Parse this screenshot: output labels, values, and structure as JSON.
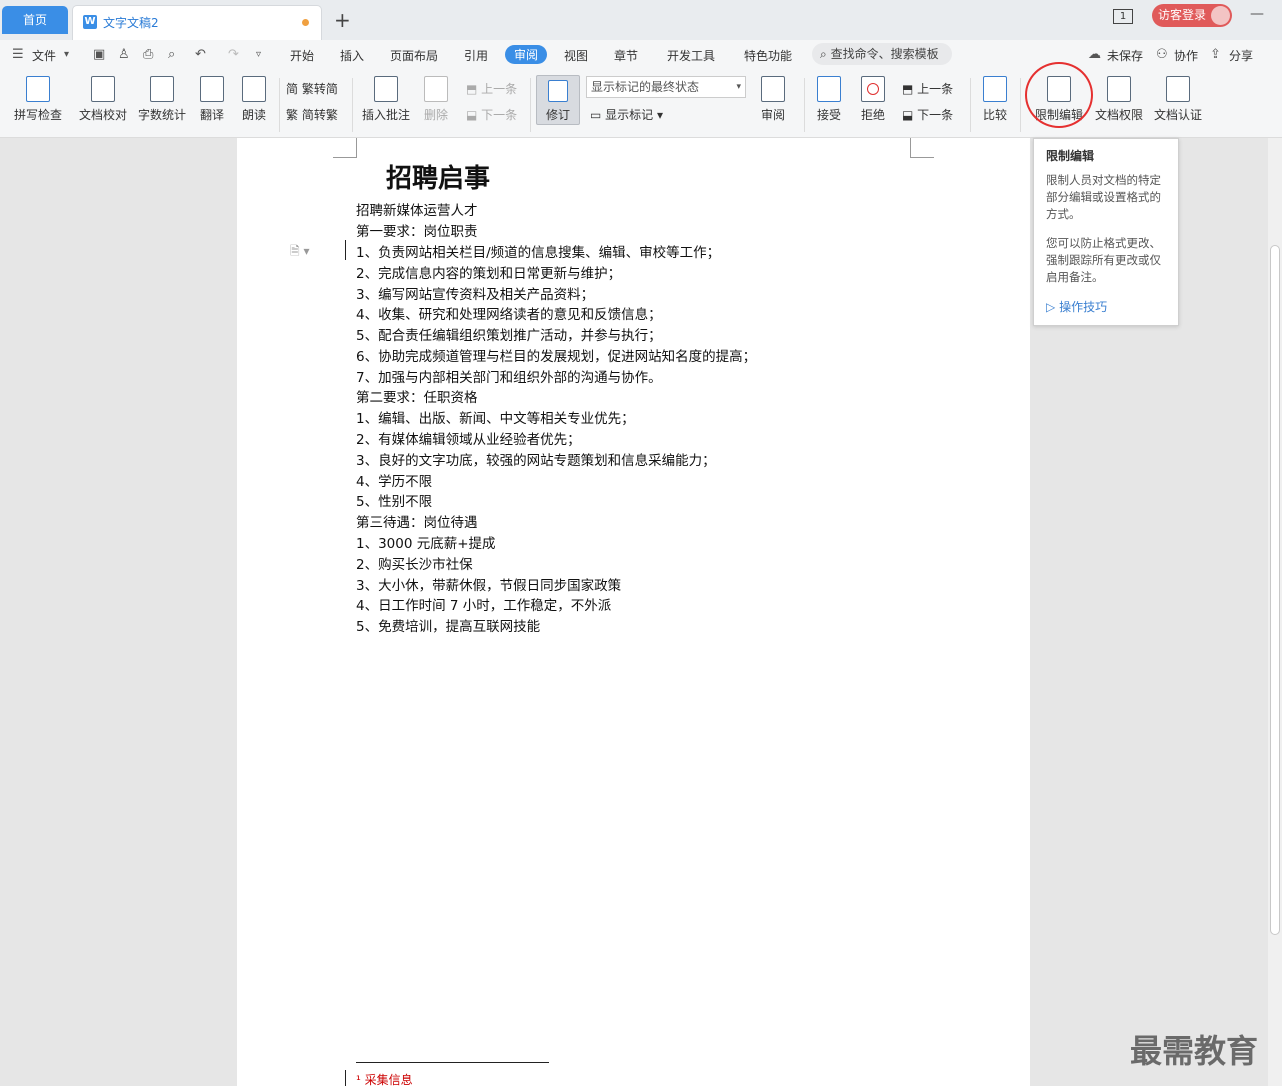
{
  "tabs": {
    "home": "首页",
    "doc": "文字文稿2",
    "add": "+"
  },
  "titlebar": {
    "win_num": "1",
    "login": "访客登录",
    "minimize": "—",
    "restore": "□"
  },
  "menu": {
    "file": "文件",
    "items": [
      "开始",
      "插入",
      "页面布局",
      "引用",
      "审阅",
      "视图",
      "章节",
      "开发工具",
      "特色功能"
    ],
    "active": "审阅",
    "search": "查找命令、搜索模板",
    "unsaved": "未保存",
    "collab": "协作",
    "share": "分享"
  },
  "ribbon": {
    "spell": "拼写检查",
    "proof": "文档校对",
    "wordcount": "字数统计",
    "translate": "翻译",
    "read": "朗读",
    "trad": "繁转简",
    "simp": "简转繁",
    "insert_comment": "插入批注",
    "delete": "删除",
    "prev": "上一条",
    "next": "下一条",
    "revise": "修订",
    "status_select": "显示标记的最终状态",
    "show_marks": "显示标记",
    "review": "审阅",
    "accept": "接受",
    "reject": "拒绝",
    "prev2": "上一条",
    "next2": "下一条",
    "compare": "比较",
    "restrict": "限制编辑",
    "perm": "文档权限",
    "cert": "文档认证"
  },
  "tooltip": {
    "title": "限制编辑",
    "body1": "限制人员对文档的特定部分编辑或设置格式的方式。",
    "body2": "您可以防止格式更改、强制跟踪所有更改或仅启用备注。",
    "link": "操作技巧"
  },
  "document": {
    "title": "招聘启事",
    "lines": [
      "招聘新媒体运营人才",
      "第一要求：岗位职责",
      "1、负责网站相关栏目/频道的信息搜集、编辑、审校等工作；",
      "2、完成信息内容的策划和日常更新与维护；",
      "3、编写网站宣传资料及相关产品资料；",
      "4、收集、研究和处理网络读者的意见和反馈信息；",
      "5、配合责任编辑组织策划推广活动，并参与执行；",
      "6、协助完成频道管理与栏目的发展规划，促进网站知名度的提高；",
      "7、加强与内部相关部门和组织外部的沟通与协作。",
      "第二要求：任职资格",
      "1、编辑、出版、新闻、中文等相关专业优先；",
      "2、有媒体编辑领域从业经验者优先；",
      "3、良好的文字功底，较强的网站专题策划和信息采编能力；",
      "4、学历不限",
      "5、性别不限",
      "第三待遇：岗位待遇",
      "1、3000 元底薪+提成",
      "2、购买长沙市社保",
      "3、大小休，带薪休假，节假日同步国家政策",
      "4、日工作时间 7 小时，工作稳定，不外派",
      "5、免费培训，提高互联网技能"
    ],
    "footnote": "¹ 采集信息"
  },
  "watermark": "最需教育"
}
